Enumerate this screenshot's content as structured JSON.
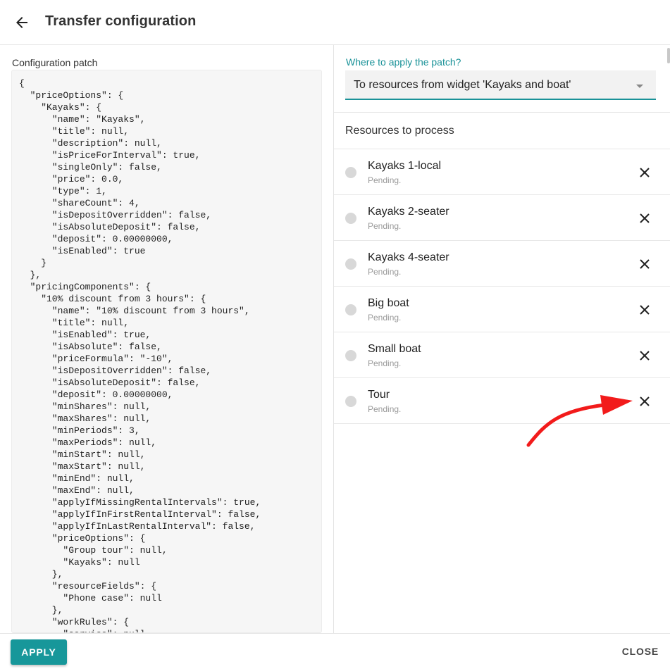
{
  "header": {
    "title": "Transfer configuration",
    "back_icon": "arrow-left-icon"
  },
  "left": {
    "label": "Configuration patch",
    "code": "{\n  \"priceOptions\": {\n    \"Kayaks\": {\n      \"name\": \"Kayaks\",\n      \"title\": null,\n      \"description\": null,\n      \"isPriceForInterval\": true,\n      \"singleOnly\": false,\n      \"price\": 0.0,\n      \"type\": 1,\n      \"shareCount\": 4,\n      \"isDepositOverridden\": false,\n      \"isAbsoluteDeposit\": false,\n      \"deposit\": 0.00000000,\n      \"isEnabled\": true\n    }\n  },\n  \"pricingComponents\": {\n    \"10% discount from 3 hours\": {\n      \"name\": \"10% discount from 3 hours\",\n      \"title\": null,\n      \"isEnabled\": true,\n      \"isAbsolute\": false,\n      \"priceFormula\": \"-10\",\n      \"isDepositOverridden\": false,\n      \"isAbsoluteDeposit\": false,\n      \"deposit\": 0.00000000,\n      \"minShares\": null,\n      \"maxShares\": null,\n      \"minPeriods\": 3,\n      \"maxPeriods\": null,\n      \"minStart\": null,\n      \"maxStart\": null,\n      \"minEnd\": null,\n      \"maxEnd\": null,\n      \"applyIfMissingRentalIntervals\": true,\n      \"applyIfInFirstRentalInterval\": false,\n      \"applyIfInLastRentalInterval\": false,\n      \"priceOptions\": {\n        \"Group tour\": null,\n        \"Kayaks\": null\n      },\n      \"resourceFields\": {\n        \"Phone case\": null\n      },\n      \"workRules\": {\n        \"service\": null"
  },
  "right": {
    "field_label": "Where to apply the patch?",
    "select_value": "To resources from widget 'Kayaks and boat'",
    "resources_heading": "Resources to process",
    "resources": [
      {
        "name": "Kayaks 1-local",
        "status": "Pending."
      },
      {
        "name": "Kayaks 2-seater",
        "status": "Pending."
      },
      {
        "name": "Kayaks 4-seater",
        "status": "Pending."
      },
      {
        "name": "Big boat",
        "status": "Pending."
      },
      {
        "name": "Small boat",
        "status": "Pending."
      },
      {
        "name": "Tour",
        "status": "Pending."
      }
    ]
  },
  "footer": {
    "apply_label": "APPLY",
    "close_label": "CLOSE"
  },
  "colors": {
    "accent": "#17979a",
    "annotation_arrow": "#f21b1b"
  }
}
